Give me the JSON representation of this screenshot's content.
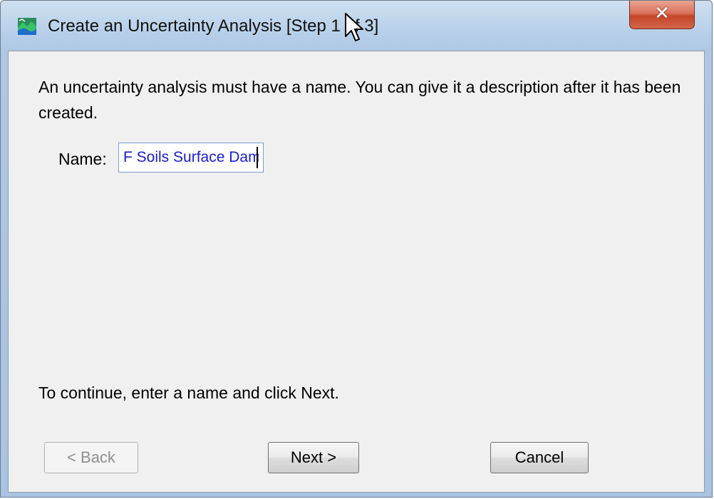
{
  "window": {
    "title": "Create an Uncertainty Analysis [Step 1 of 3]",
    "close_label": "✕"
  },
  "content": {
    "intro_text": "An uncertainty analysis must have a name. You can give it a description after it has been created.",
    "name_label": "Name:",
    "name_value": "F Soils Surface Dam",
    "hint_text": "To continue, enter a name and click Next."
  },
  "buttons": {
    "back_label": "< Back",
    "next_label": "Next >",
    "cancel_label": "Cancel",
    "back_enabled": false
  },
  "colors": {
    "title_bar": "#b9d1ea",
    "close_button": "#c6452b",
    "client_background": "#f0f0f0",
    "input_text": "#1a1ad6"
  },
  "icons": {
    "app": "landscape-icon",
    "close": "close-icon",
    "cursor": "mouse-pointer-icon"
  }
}
